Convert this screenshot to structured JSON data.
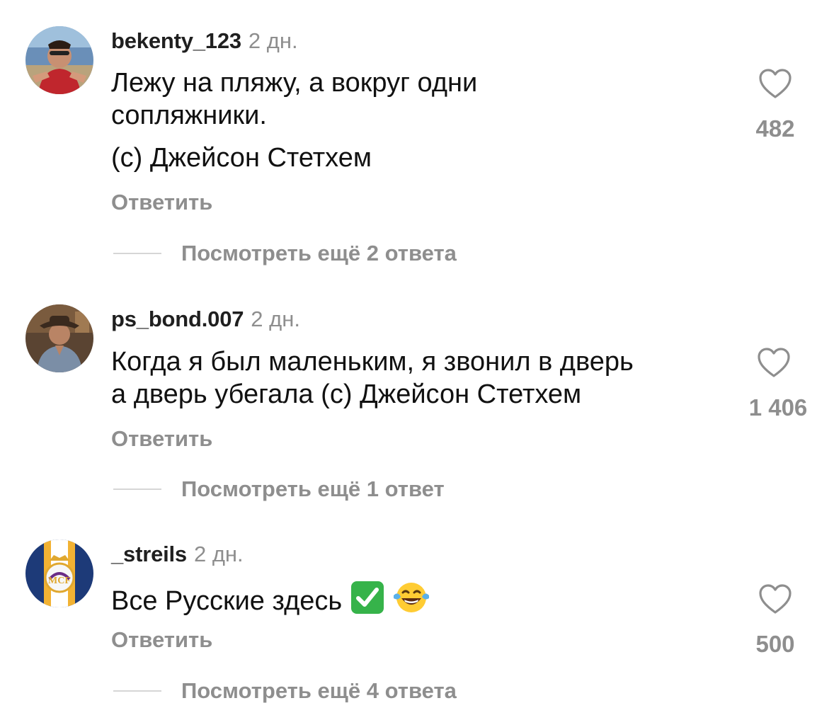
{
  "comments": [
    {
      "username": "bekenty_123",
      "time": "2 дн.",
      "text_lines": [
        "Лежу на пляжу, а вокруг одни",
        "сопляжники."
      ],
      "text_extra": "(с) Джейсон Стетхем",
      "reply_label": "Ответить",
      "likes": "482",
      "more_replies": "Посмотреть ещё 2 ответа"
    },
    {
      "username": "ps_bond.007",
      "time": "2 дн.",
      "text_lines": [
        "Когда я был маленьким,  я звонил в дверь",
        "а дверь убегала (с) Джейсон Стетхем"
      ],
      "reply_label": "Ответить",
      "likes": "1 406",
      "more_replies": "Посмотреть ещё 1 ответ"
    },
    {
      "username": "_streils",
      "time": "2 дн.",
      "text_lines": [
        "Все Русские  здесь"
      ],
      "emojis": [
        "check-mark-emoji",
        "laughing-tears-emoji"
      ],
      "reply_label": "Ответить",
      "likes": "500",
      "more_replies": "Посмотреть ещё 4 ответа"
    }
  ],
  "icons": {
    "like": "heart-outline-icon"
  },
  "colors": {
    "secondary_text": "#8e8e8e",
    "primary_text": "#111111",
    "divider": "#d6d6d6",
    "check_green": "#36b34a"
  }
}
